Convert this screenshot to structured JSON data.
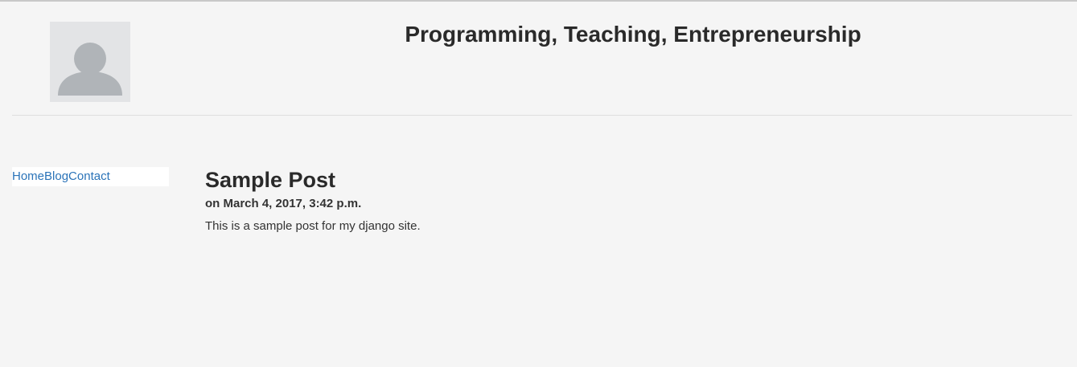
{
  "header": {
    "title": "Programming, Teaching, Entrepreneurship",
    "avatar_icon": "default-user-icon"
  },
  "nav": {
    "items": [
      {
        "label": "Home"
      },
      {
        "label": "Blog"
      },
      {
        "label": "Contact"
      }
    ]
  },
  "post": {
    "title": "Sample Post",
    "date": "on March 4, 2017, 3:42 p.m.",
    "body": "This is a sample post for my django site."
  },
  "colors": {
    "background": "#f5f5f5",
    "link": "#2a73b8",
    "avatar_bg": "#e3e4e6",
    "avatar_fg": "#b0b4b8"
  }
}
